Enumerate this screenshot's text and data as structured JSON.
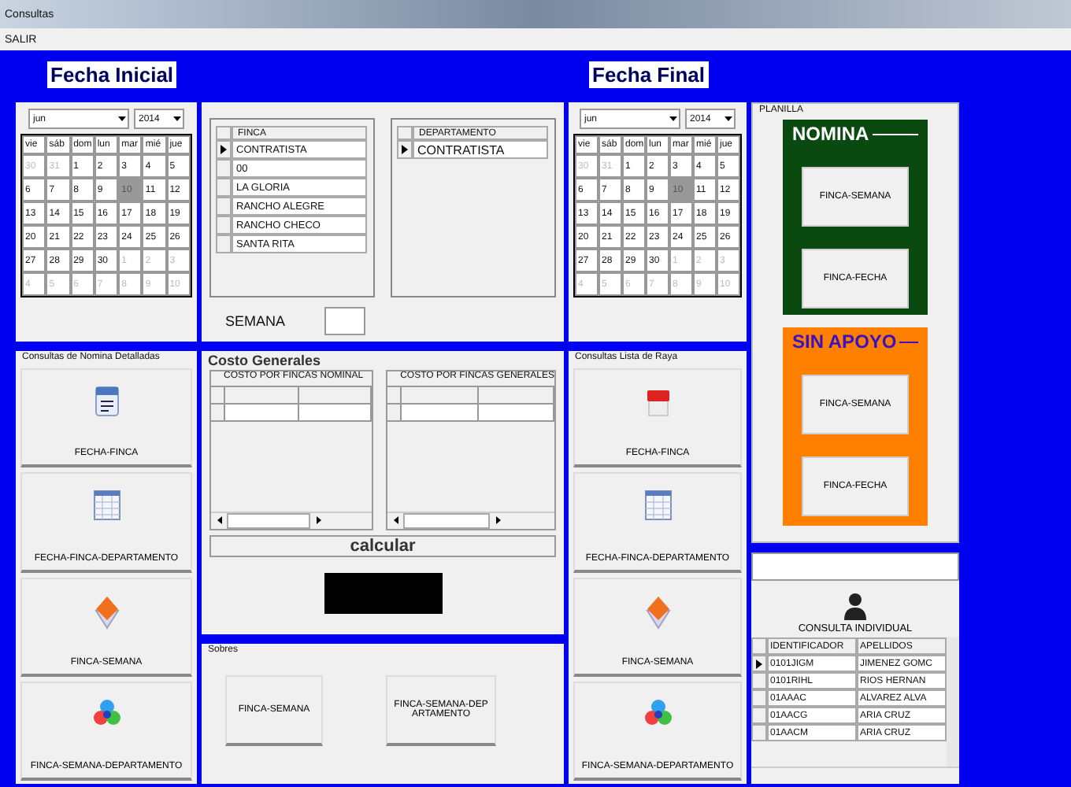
{
  "window": {
    "title": "Consultas"
  },
  "menu": [
    "SALIR"
  ],
  "start": {
    "heading": "Fecha Inicial",
    "month": "jun",
    "year": "2014",
    "weekdays": [
      "vie",
      "sáb",
      "dom",
      "lun",
      "mar",
      "mié",
      "jue"
    ],
    "days": [
      {
        "d": "30",
        "other": true,
        "selected": false
      },
      {
        "d": "31",
        "other": true,
        "selected": false
      },
      {
        "d": "1",
        "other": false,
        "selected": false
      },
      {
        "d": "2",
        "other": false,
        "selected": false
      },
      {
        "d": "3",
        "other": false,
        "selected": false
      },
      {
        "d": "4",
        "other": false,
        "selected": false
      },
      {
        "d": "5",
        "other": false,
        "selected": false
      },
      {
        "d": "6",
        "other": false,
        "selected": false
      },
      {
        "d": "7",
        "other": false,
        "selected": false
      },
      {
        "d": "8",
        "other": false,
        "selected": false
      },
      {
        "d": "9",
        "other": false,
        "selected": false
      },
      {
        "d": "10",
        "other": false,
        "selected": true
      },
      {
        "d": "11",
        "other": false,
        "selected": false
      },
      {
        "d": "12",
        "other": false,
        "selected": false
      },
      {
        "d": "13",
        "other": false,
        "selected": false
      },
      {
        "d": "14",
        "other": false,
        "selected": false
      },
      {
        "d": "15",
        "other": false,
        "selected": false
      },
      {
        "d": "16",
        "other": false,
        "selected": false
      },
      {
        "d": "17",
        "other": false,
        "selected": false
      },
      {
        "d": "18",
        "other": false,
        "selected": false
      },
      {
        "d": "19",
        "other": false,
        "selected": false
      },
      {
        "d": "20",
        "other": false,
        "selected": false
      },
      {
        "d": "21",
        "other": false,
        "selected": false
      },
      {
        "d": "22",
        "other": false,
        "selected": false
      },
      {
        "d": "23",
        "other": false,
        "selected": false
      },
      {
        "d": "24",
        "other": false,
        "selected": false
      },
      {
        "d": "25",
        "other": false,
        "selected": false
      },
      {
        "d": "26",
        "other": false,
        "selected": false
      },
      {
        "d": "27",
        "other": false,
        "selected": false
      },
      {
        "d": "28",
        "other": false,
        "selected": false
      },
      {
        "d": "29",
        "other": false,
        "selected": false
      },
      {
        "d": "30",
        "other": false,
        "selected": false
      },
      {
        "d": "1",
        "other": true,
        "selected": false
      },
      {
        "d": "2",
        "other": true,
        "selected": false
      },
      {
        "d": "3",
        "other": true,
        "selected": false
      },
      {
        "d": "4",
        "other": true,
        "selected": false
      },
      {
        "d": "5",
        "other": true,
        "selected": false
      },
      {
        "d": "6",
        "other": true,
        "selected": false
      },
      {
        "d": "7",
        "other": true,
        "selected": false
      },
      {
        "d": "8",
        "other": true,
        "selected": false
      },
      {
        "d": "9",
        "other": true,
        "selected": false
      },
      {
        "d": "10",
        "other": true,
        "selected": false
      }
    ]
  },
  "end": {
    "heading": "Fecha Final",
    "month": "jun",
    "year": "2014",
    "weekdays": [
      "vie",
      "sáb",
      "dom",
      "lun",
      "mar",
      "mié",
      "jue"
    ],
    "days": [
      {
        "d": "30",
        "other": true,
        "selected": false
      },
      {
        "d": "31",
        "other": true,
        "selected": false
      },
      {
        "d": "1",
        "other": false,
        "selected": false
      },
      {
        "d": "2",
        "other": false,
        "selected": false
      },
      {
        "d": "3",
        "other": false,
        "selected": false
      },
      {
        "d": "4",
        "other": false,
        "selected": false
      },
      {
        "d": "5",
        "other": false,
        "selected": false
      },
      {
        "d": "6",
        "other": false,
        "selected": false
      },
      {
        "d": "7",
        "other": false,
        "selected": false
      },
      {
        "d": "8",
        "other": false,
        "selected": false
      },
      {
        "d": "9",
        "other": false,
        "selected": false
      },
      {
        "d": "10",
        "other": false,
        "selected": true
      },
      {
        "d": "11",
        "other": false,
        "selected": false
      },
      {
        "d": "12",
        "other": false,
        "selected": false
      },
      {
        "d": "13",
        "other": false,
        "selected": false
      },
      {
        "d": "14",
        "other": false,
        "selected": false
      },
      {
        "d": "15",
        "other": false,
        "selected": false
      },
      {
        "d": "16",
        "other": false,
        "selected": false
      },
      {
        "d": "17",
        "other": false,
        "selected": false
      },
      {
        "d": "18",
        "other": false,
        "selected": false
      },
      {
        "d": "19",
        "other": false,
        "selected": false
      },
      {
        "d": "20",
        "other": false,
        "selected": false
      },
      {
        "d": "21",
        "other": false,
        "selected": false
      },
      {
        "d": "22",
        "other": false,
        "selected": false
      },
      {
        "d": "23",
        "other": false,
        "selected": false
      },
      {
        "d": "24",
        "other": false,
        "selected": false
      },
      {
        "d": "25",
        "other": false,
        "selected": false
      },
      {
        "d": "26",
        "other": false,
        "selected": false
      },
      {
        "d": "27",
        "other": false,
        "selected": false
      },
      {
        "d": "28",
        "other": false,
        "selected": false
      },
      {
        "d": "29",
        "other": false,
        "selected": false
      },
      {
        "d": "30",
        "other": false,
        "selected": false
      },
      {
        "d": "1",
        "other": true,
        "selected": false
      },
      {
        "d": "2",
        "other": true,
        "selected": false
      },
      {
        "d": "3",
        "other": true,
        "selected": false
      },
      {
        "d": "4",
        "other": true,
        "selected": false
      },
      {
        "d": "5",
        "other": true,
        "selected": false
      },
      {
        "d": "6",
        "other": true,
        "selected": false
      },
      {
        "d": "7",
        "other": true,
        "selected": false
      },
      {
        "d": "8",
        "other": true,
        "selected": false
      },
      {
        "d": "9",
        "other": true,
        "selected": false
      },
      {
        "d": "10",
        "other": true,
        "selected": false
      }
    ]
  },
  "finca_grid": {
    "column": "FINCA",
    "rows": [
      {
        "value": "CONTRATISTA",
        "current": true
      },
      {
        "value": "00",
        "current": false
      },
      {
        "value": "LA GLORIA",
        "current": false
      },
      {
        "value": "RANCHO ALEGRE",
        "current": false
      },
      {
        "value": "RANCHO CHECO",
        "current": false
      },
      {
        "value": "SANTA RITA",
        "current": false
      }
    ]
  },
  "departamento_grid": {
    "column": "DEPARTAMENTO",
    "rows": [
      {
        "value": "CONTRATISTA",
        "current": true
      }
    ]
  },
  "semana": {
    "label": "SEMANA"
  },
  "nomina_detalle": {
    "title": "Consultas de Nomina Detalladas",
    "buttons": [
      {
        "label": "FECHA-FINCA",
        "kind": "calendar"
      },
      {
        "label": "FECHA-FINCA-DEPARTAMENTO",
        "kind": "table"
      },
      {
        "label": "FINCA-SEMANA",
        "kind": "gem"
      },
      {
        "label": "FINCA-SEMANA-DEPARTAMENTO",
        "kind": "circles"
      }
    ]
  },
  "costo": {
    "title": "Costo Generales",
    "grids": [
      {
        "column": "COSTO POR FINCAS NOMINAL"
      },
      {
        "column": "COSTO POR FINCAS GENERALES"
      }
    ],
    "button": "calcular"
  },
  "sobres": {
    "title": "Sobres",
    "buttons": [
      "FINCA-SEMANA",
      "FINCA-SEMANA-DEPARTAMENTO"
    ]
  },
  "lista_raya": {
    "title": "Consultas  Lista de Raya",
    "buttons": [
      {
        "label": "FECHA-FINCA",
        "kind": "pdf"
      },
      {
        "label": "FECHA-FINCA-DEPARTAMENTO",
        "kind": "table"
      },
      {
        "label": "FINCA-SEMANA",
        "kind": "gem"
      },
      {
        "label": "FINCA-SEMANA-DEPARTAMENTO",
        "kind": "circles"
      }
    ]
  },
  "planilla": {
    "title": "PLANILLA",
    "groups": [
      {
        "title": "NOMINA",
        "kind": "dark",
        "color": "#0a4a10",
        "buttons": [
          "FINCA-SEMANA",
          "FINCA-FECHA"
        ]
      },
      {
        "title": "SIN APOYO",
        "kind": "light",
        "color": "#ff8000",
        "buttons": [
          "FINCA-SEMANA",
          "FINCA-FECHA"
        ]
      }
    ]
  },
  "consulta": {
    "button": "CONSULTA INDIVIDUAL",
    "columns": [
      "IDENTIFICADOR",
      "APELLIDOS"
    ],
    "rows": [
      {
        "cells": [
          "0101JIGM",
          "JIMENEZ GOMC"
        ],
        "current": true
      },
      {
        "cells": [
          "0101RIHL",
          "RIOS HERNAN"
        ],
        "current": false
      },
      {
        "cells": [
          "01AAAC",
          "ALVAREZ ALVA"
        ],
        "current": false
      },
      {
        "cells": [
          "01AACG",
          "ARIA CRUZ"
        ],
        "current": false
      },
      {
        "cells": [
          "01AACM",
          "ARIA CRUZ"
        ],
        "current": false
      }
    ]
  }
}
